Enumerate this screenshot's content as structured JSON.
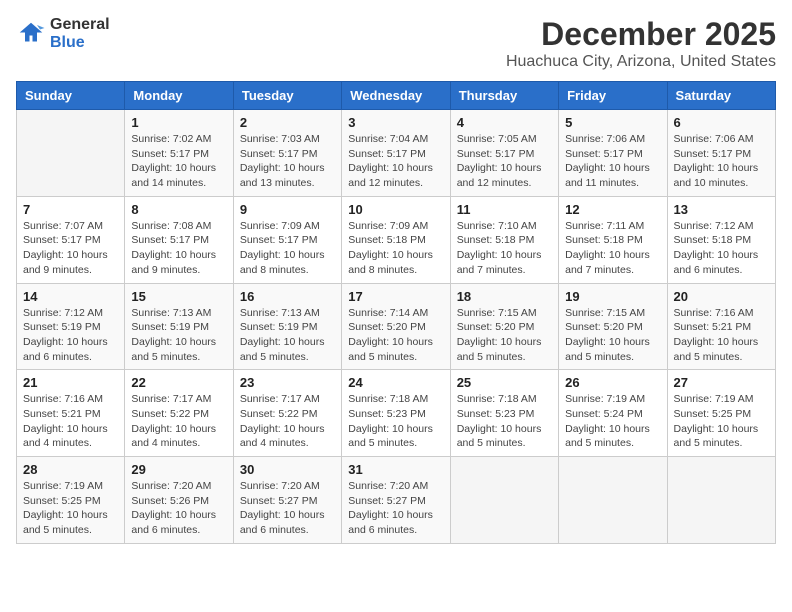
{
  "logo": {
    "line1": "General",
    "line2": "Blue"
  },
  "title": {
    "month": "December 2025",
    "location": "Huachuca City, Arizona, United States"
  },
  "headers": [
    "Sunday",
    "Monday",
    "Tuesday",
    "Wednesday",
    "Thursday",
    "Friday",
    "Saturday"
  ],
  "weeks": [
    [
      {
        "day": "",
        "sunrise": "",
        "sunset": "",
        "daylight": ""
      },
      {
        "day": "1",
        "sunrise": "Sunrise: 7:02 AM",
        "sunset": "Sunset: 5:17 PM",
        "daylight": "Daylight: 10 hours and 14 minutes."
      },
      {
        "day": "2",
        "sunrise": "Sunrise: 7:03 AM",
        "sunset": "Sunset: 5:17 PM",
        "daylight": "Daylight: 10 hours and 13 minutes."
      },
      {
        "day": "3",
        "sunrise": "Sunrise: 7:04 AM",
        "sunset": "Sunset: 5:17 PM",
        "daylight": "Daylight: 10 hours and 12 minutes."
      },
      {
        "day": "4",
        "sunrise": "Sunrise: 7:05 AM",
        "sunset": "Sunset: 5:17 PM",
        "daylight": "Daylight: 10 hours and 12 minutes."
      },
      {
        "day": "5",
        "sunrise": "Sunrise: 7:06 AM",
        "sunset": "Sunset: 5:17 PM",
        "daylight": "Daylight: 10 hours and 11 minutes."
      },
      {
        "day": "6",
        "sunrise": "Sunrise: 7:06 AM",
        "sunset": "Sunset: 5:17 PM",
        "daylight": "Daylight: 10 hours and 10 minutes."
      }
    ],
    [
      {
        "day": "7",
        "sunrise": "Sunrise: 7:07 AM",
        "sunset": "Sunset: 5:17 PM",
        "daylight": "Daylight: 10 hours and 9 minutes."
      },
      {
        "day": "8",
        "sunrise": "Sunrise: 7:08 AM",
        "sunset": "Sunset: 5:17 PM",
        "daylight": "Daylight: 10 hours and 9 minutes."
      },
      {
        "day": "9",
        "sunrise": "Sunrise: 7:09 AM",
        "sunset": "Sunset: 5:17 PM",
        "daylight": "Daylight: 10 hours and 8 minutes."
      },
      {
        "day": "10",
        "sunrise": "Sunrise: 7:09 AM",
        "sunset": "Sunset: 5:18 PM",
        "daylight": "Daylight: 10 hours and 8 minutes."
      },
      {
        "day": "11",
        "sunrise": "Sunrise: 7:10 AM",
        "sunset": "Sunset: 5:18 PM",
        "daylight": "Daylight: 10 hours and 7 minutes."
      },
      {
        "day": "12",
        "sunrise": "Sunrise: 7:11 AM",
        "sunset": "Sunset: 5:18 PM",
        "daylight": "Daylight: 10 hours and 7 minutes."
      },
      {
        "day": "13",
        "sunrise": "Sunrise: 7:12 AM",
        "sunset": "Sunset: 5:18 PM",
        "daylight": "Daylight: 10 hours and 6 minutes."
      }
    ],
    [
      {
        "day": "14",
        "sunrise": "Sunrise: 7:12 AM",
        "sunset": "Sunset: 5:19 PM",
        "daylight": "Daylight: 10 hours and 6 minutes."
      },
      {
        "day": "15",
        "sunrise": "Sunrise: 7:13 AM",
        "sunset": "Sunset: 5:19 PM",
        "daylight": "Daylight: 10 hours and 5 minutes."
      },
      {
        "day": "16",
        "sunrise": "Sunrise: 7:13 AM",
        "sunset": "Sunset: 5:19 PM",
        "daylight": "Daylight: 10 hours and 5 minutes."
      },
      {
        "day": "17",
        "sunrise": "Sunrise: 7:14 AM",
        "sunset": "Sunset: 5:20 PM",
        "daylight": "Daylight: 10 hours and 5 minutes."
      },
      {
        "day": "18",
        "sunrise": "Sunrise: 7:15 AM",
        "sunset": "Sunset: 5:20 PM",
        "daylight": "Daylight: 10 hours and 5 minutes."
      },
      {
        "day": "19",
        "sunrise": "Sunrise: 7:15 AM",
        "sunset": "Sunset: 5:20 PM",
        "daylight": "Daylight: 10 hours and 5 minutes."
      },
      {
        "day": "20",
        "sunrise": "Sunrise: 7:16 AM",
        "sunset": "Sunset: 5:21 PM",
        "daylight": "Daylight: 10 hours and 5 minutes."
      }
    ],
    [
      {
        "day": "21",
        "sunrise": "Sunrise: 7:16 AM",
        "sunset": "Sunset: 5:21 PM",
        "daylight": "Daylight: 10 hours and 4 minutes."
      },
      {
        "day": "22",
        "sunrise": "Sunrise: 7:17 AM",
        "sunset": "Sunset: 5:22 PM",
        "daylight": "Daylight: 10 hours and 4 minutes."
      },
      {
        "day": "23",
        "sunrise": "Sunrise: 7:17 AM",
        "sunset": "Sunset: 5:22 PM",
        "daylight": "Daylight: 10 hours and 4 minutes."
      },
      {
        "day": "24",
        "sunrise": "Sunrise: 7:18 AM",
        "sunset": "Sunset: 5:23 PM",
        "daylight": "Daylight: 10 hours and 5 minutes."
      },
      {
        "day": "25",
        "sunrise": "Sunrise: 7:18 AM",
        "sunset": "Sunset: 5:23 PM",
        "daylight": "Daylight: 10 hours and 5 minutes."
      },
      {
        "day": "26",
        "sunrise": "Sunrise: 7:19 AM",
        "sunset": "Sunset: 5:24 PM",
        "daylight": "Daylight: 10 hours and 5 minutes."
      },
      {
        "day": "27",
        "sunrise": "Sunrise: 7:19 AM",
        "sunset": "Sunset: 5:25 PM",
        "daylight": "Daylight: 10 hours and 5 minutes."
      }
    ],
    [
      {
        "day": "28",
        "sunrise": "Sunrise: 7:19 AM",
        "sunset": "Sunset: 5:25 PM",
        "daylight": "Daylight: 10 hours and 5 minutes."
      },
      {
        "day": "29",
        "sunrise": "Sunrise: 7:20 AM",
        "sunset": "Sunset: 5:26 PM",
        "daylight": "Daylight: 10 hours and 6 minutes."
      },
      {
        "day": "30",
        "sunrise": "Sunrise: 7:20 AM",
        "sunset": "Sunset: 5:27 PM",
        "daylight": "Daylight: 10 hours and 6 minutes."
      },
      {
        "day": "31",
        "sunrise": "Sunrise: 7:20 AM",
        "sunset": "Sunset: 5:27 PM",
        "daylight": "Daylight: 10 hours and 6 minutes."
      },
      {
        "day": "",
        "sunrise": "",
        "sunset": "",
        "daylight": ""
      },
      {
        "day": "",
        "sunrise": "",
        "sunset": "",
        "daylight": ""
      },
      {
        "day": "",
        "sunrise": "",
        "sunset": "",
        "daylight": ""
      }
    ]
  ]
}
